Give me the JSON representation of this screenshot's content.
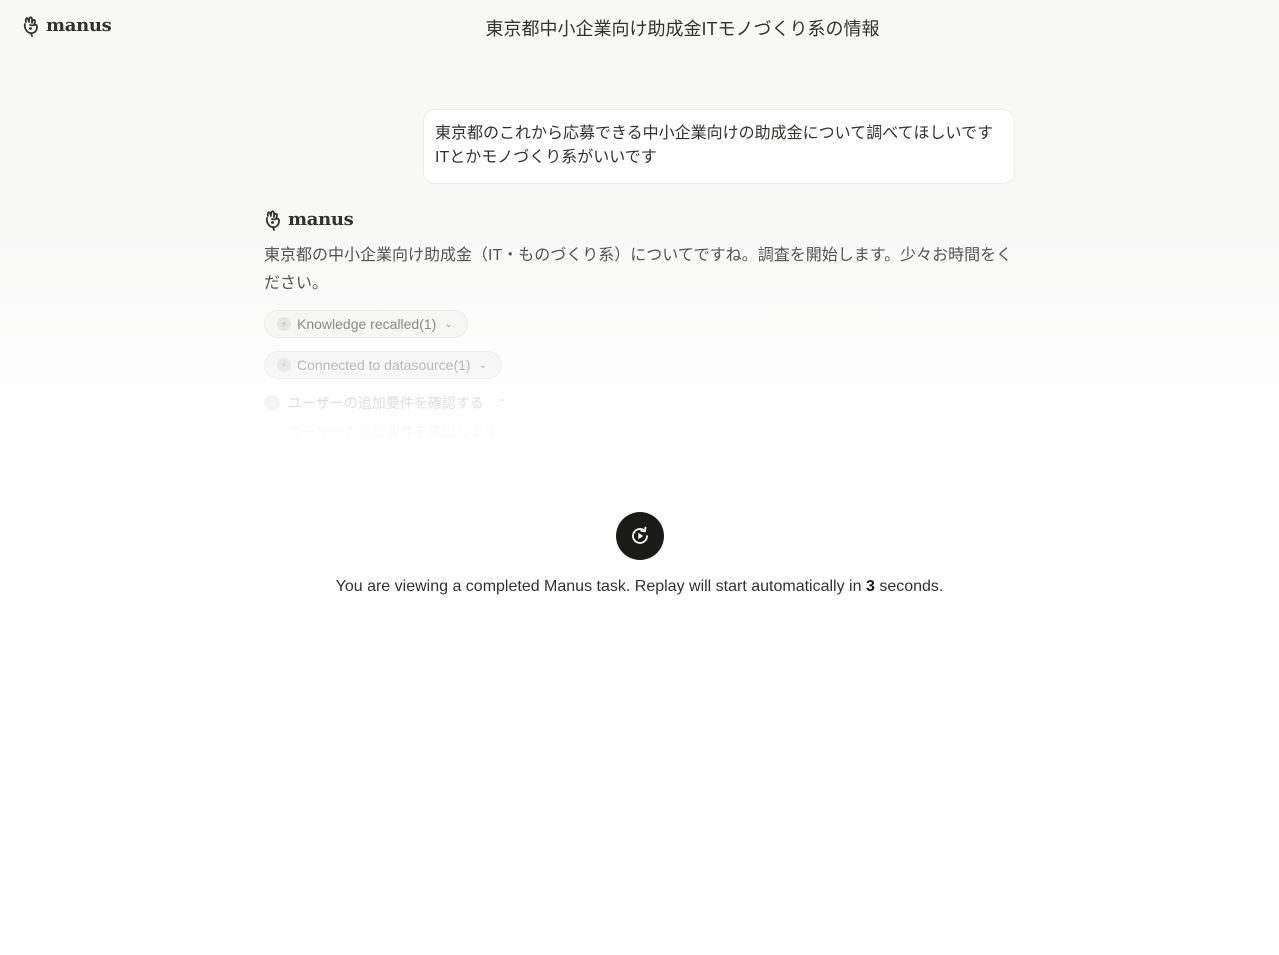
{
  "header": {
    "logo_text": "manus",
    "title": "東京都中小企業向け助成金ITモノづくり系の情報"
  },
  "user_message": {
    "line1": "東京都のこれから応募できる中小企業向けの助成金について調べてほしいです",
    "line2": "ITとかモノづくり系がいいです"
  },
  "assistant": {
    "logo_text": "manus",
    "message": "東京都の中小企業向け助成金（IT・ものづくり系）についてですね。調査を開始します。少々お時間をください。",
    "chips": [
      {
        "label": "Knowledge recalled(1)",
        "icon": "bolt-icon"
      },
      {
        "label": "Connected to datasource(1)",
        "icon": "bolt-icon"
      }
    ],
    "step": {
      "title": "ユーザーの追加要件を確認する",
      "detail": "ユーザーの追加要件を確認します"
    }
  },
  "replay": {
    "icon": "replay-icon",
    "text_before": "You are viewing a completed Manus task. Replay will start automatically in",
    "countdown": "3",
    "text_after": "seconds."
  },
  "colors": {
    "text": "#34322d",
    "button_bg": "#1a1a19",
    "muted": "#8a8a86"
  }
}
